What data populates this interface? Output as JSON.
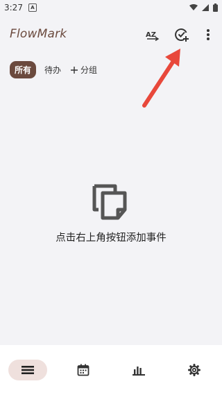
{
  "status_bar": {
    "time": "3:27",
    "notification_glyph": "A"
  },
  "app_bar": {
    "title": "FlowMark",
    "sort_icon_text": "AZ"
  },
  "filters": {
    "all": "所有",
    "todo": "待办",
    "add_group": "分组"
  },
  "empty_state": {
    "message": "点击右上角按钮添加事件"
  },
  "colors": {
    "brand": "#6b4a3e",
    "background": "#f3f3f6",
    "nav_active": "#efe0dd",
    "annotation_arrow": "#e8483b"
  },
  "icons": {
    "sort": "sort-az-icon",
    "add_event": "check-circle-plus-icon",
    "menu": "more-vert-icon",
    "empty": "copy-documents-icon",
    "nav": [
      "list-icon",
      "calendar-icon",
      "bar-chart-icon",
      "gear-icon"
    ]
  }
}
